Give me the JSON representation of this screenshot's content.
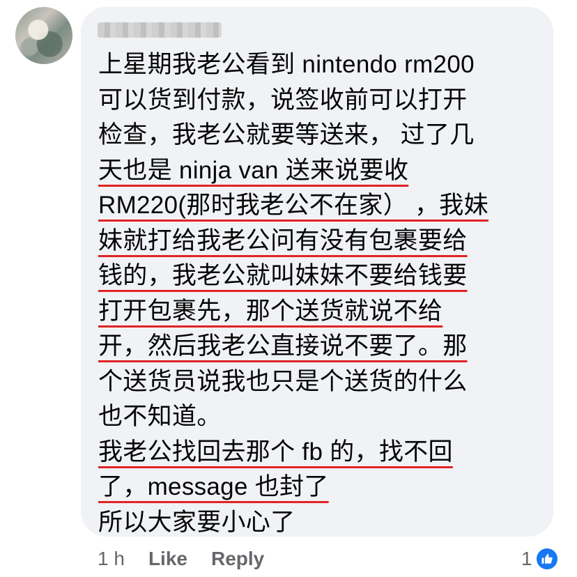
{
  "comment": {
    "author_name": "",
    "lines": [
      {
        "text": "上星期我老公看到 nintendo rm200",
        "underlined": false
      },
      {
        "text": "可以货到付款，说签收前可以打开",
        "underlined": false
      },
      {
        "text": "检查，我老公就要等送来， 过了几",
        "underlined": false
      },
      {
        "text": "天也是 ninja van 送来说要收",
        "underlined": true
      },
      {
        "text": "RM220(那时我老公不在家） ，我妹",
        "underlined": true
      },
      {
        "text": "妹就打给我老公问有没有包裹要给",
        "underlined": true
      },
      {
        "text": "钱的，我老公就叫妹妹不要给钱要",
        "underlined": true
      },
      {
        "text": "打开包裹先，那个送货就说不给",
        "underlined": true
      },
      {
        "text": "开，然后我老公直接说不要了。那",
        "underlined": true
      },
      {
        "text": "个送货员说我也只是个送货的什么",
        "underlined": false
      },
      {
        "text": "也不知道。",
        "underlined": false
      },
      {
        "text": "我老公找回去那个 fb 的，找不回",
        "underlined": true
      },
      {
        "text": "了，message 也封了",
        "underlined": true
      },
      {
        "text": "所以大家要小心了",
        "underlined": false
      }
    ]
  },
  "footer": {
    "time": "1 h",
    "like_label": "Like",
    "reply_label": "Reply",
    "reaction_count": "1",
    "reaction_icon": "thumbs-up-icon"
  },
  "colors": {
    "bubble": "#f0f2f5",
    "text": "#050505",
    "meta": "#65676b",
    "underline": "#e02424",
    "like_badge": "#1877f2"
  }
}
